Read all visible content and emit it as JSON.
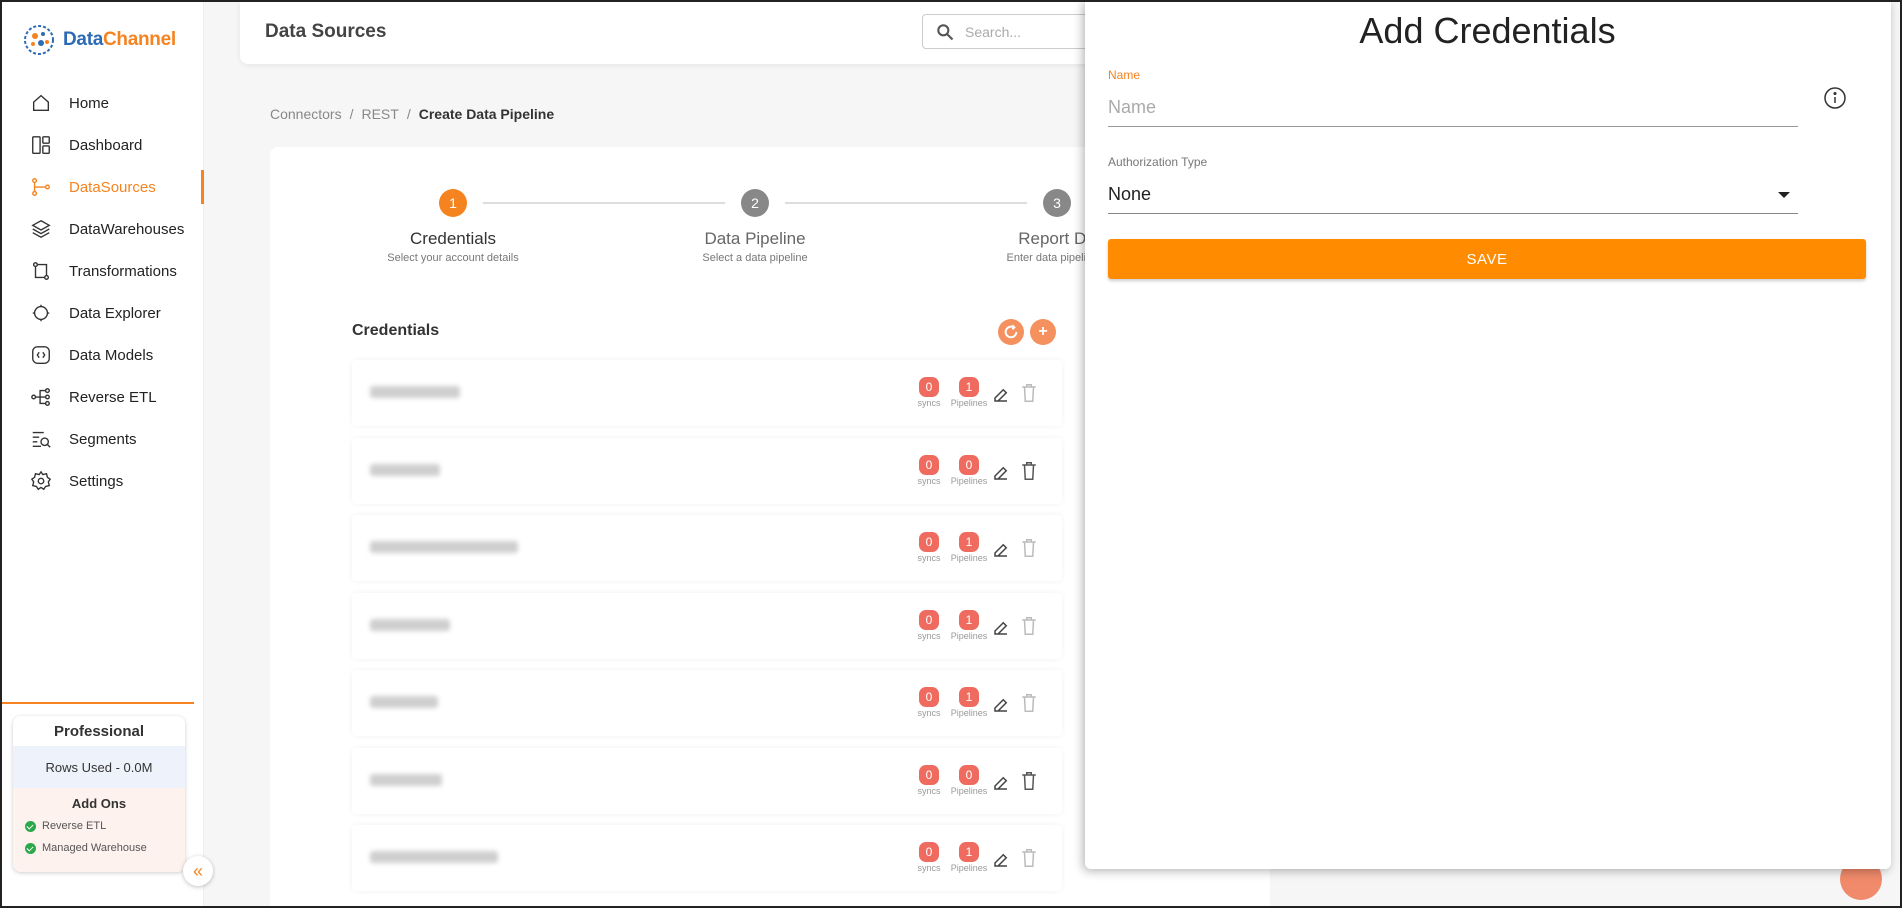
{
  "app": {
    "brand_part1": "Data",
    "brand_part2": "Channel"
  },
  "sidebar": {
    "items": [
      {
        "label": "Home",
        "icon": "home-icon"
      },
      {
        "label": "Dashboard",
        "icon": "dashboard-icon"
      },
      {
        "label": "DataSources",
        "icon": "datasources-icon",
        "active": true
      },
      {
        "label": "DataWarehouses",
        "icon": "layers-icon"
      },
      {
        "label": "Transformations",
        "icon": "transform-icon"
      },
      {
        "label": "Data Explorer",
        "icon": "explorer-icon"
      },
      {
        "label": "Data Models",
        "icon": "models-icon"
      },
      {
        "label": "Reverse ETL",
        "icon": "reverse-etl-icon"
      },
      {
        "label": "Segments",
        "icon": "segments-icon"
      },
      {
        "label": "Settings",
        "icon": "gear-icon"
      }
    ],
    "plan": {
      "title": "Professional",
      "rows_used": "Rows Used - 0.0M",
      "addons_title": "Add Ons",
      "addons": [
        "Reverse ETL",
        "Managed Warehouse"
      ]
    }
  },
  "header": {
    "title": "Data Sources",
    "search_placeholder": "Search..."
  },
  "breadcrumb": {
    "items": [
      "Connectors",
      "REST"
    ],
    "separator": "/",
    "current": "Create Data Pipeline"
  },
  "stepper": {
    "steps": [
      {
        "num": "1",
        "title": "Credentials",
        "sub": "Select your account details"
      },
      {
        "num": "2",
        "title": "Data Pipeline",
        "sub": "Select a data pipeline"
      },
      {
        "num": "3",
        "title": "Report De",
        "sub": "Enter data pipeline d"
      }
    ]
  },
  "credentials": {
    "heading": "Credentials",
    "refresh_icon": "refresh-icon",
    "add_label": "+",
    "syncs_label": "syncs",
    "pipelines_label": "Pipelines",
    "rows": [
      {
        "syncs": "0",
        "pipelines": "1"
      },
      {
        "syncs": "0",
        "pipelines": "0"
      },
      {
        "syncs": "0",
        "pipelines": "1"
      },
      {
        "syncs": "0",
        "pipelines": "1"
      },
      {
        "syncs": "0",
        "pipelines": "1"
      },
      {
        "syncs": "0",
        "pipelines": "0"
      },
      {
        "syncs": "0",
        "pipelines": "1"
      }
    ]
  },
  "panel": {
    "title": "Add Credentials",
    "name_label": "Name",
    "name_placeholder": "Name",
    "name_value": "",
    "auth_label": "Authorization Type",
    "auth_value": "None",
    "save_label": "SAVE"
  },
  "colors": {
    "accent": "#f5831f",
    "save": "#ff8c00",
    "badge": "#ef6b5f",
    "brand_blue": "#2d6bb5"
  }
}
